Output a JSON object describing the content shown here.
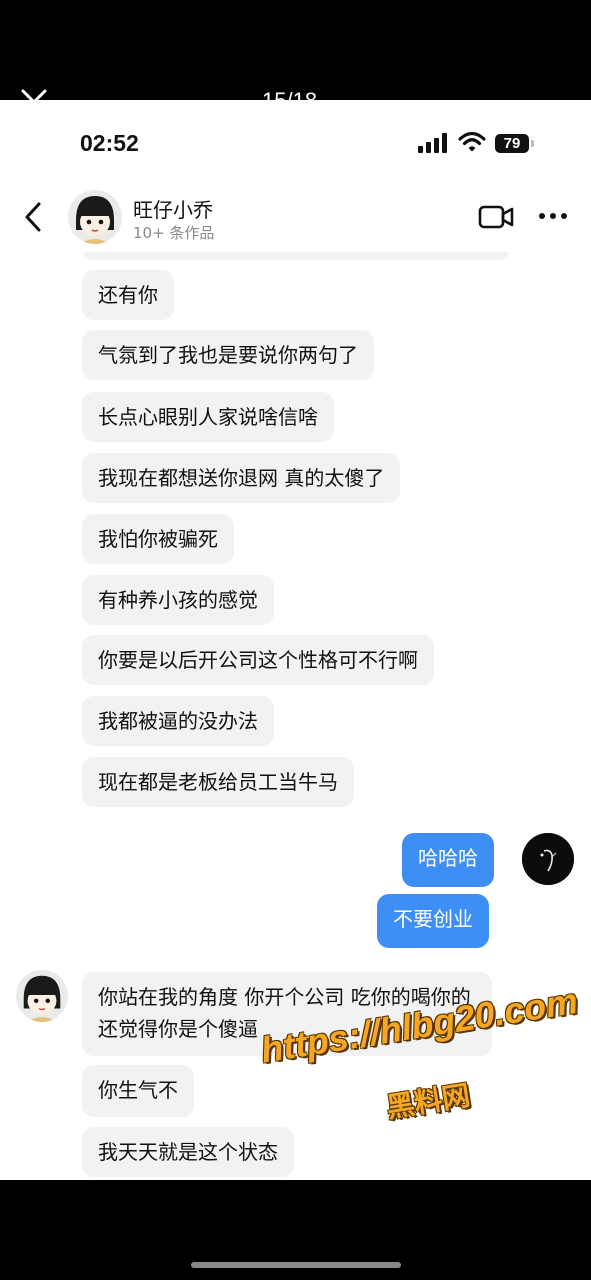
{
  "viewer": {
    "counter": "15/18",
    "close_icon": "close-icon"
  },
  "status_bar": {
    "time": "02:52",
    "battery": "79",
    "icons": [
      "signal-icon",
      "wifi-icon",
      "battery-icon"
    ]
  },
  "header": {
    "contact_name": "旺仔小乔",
    "subtitle": "10+ 条作品",
    "icons": [
      "back-icon",
      "video-call-icon",
      "more-icon"
    ]
  },
  "messages": [
    {
      "side": "in",
      "text": "还有你"
    },
    {
      "side": "in",
      "text": "气氛到了我也是要说你两句了"
    },
    {
      "side": "in",
      "text": "长点心眼别人家说啥信啥"
    },
    {
      "side": "in",
      "text": "我现在都想送你退网 真的太傻了"
    },
    {
      "side": "in",
      "text": "我怕你被骗死"
    },
    {
      "side": "in",
      "text": "有种养小孩的感觉"
    },
    {
      "side": "in",
      "text": "你要是以后开公司这个性格可不行啊"
    },
    {
      "side": "in",
      "text": "我都被逼的没办法"
    },
    {
      "side": "in",
      "text": "现在都是老板给员工当牛马"
    },
    {
      "side": "out",
      "text": "哈哈哈"
    },
    {
      "side": "out",
      "text": "不要创业"
    },
    {
      "side": "in",
      "text": "你站在我的角度 你开个公司 吃你的喝你的 还觉得你是个傻逼"
    },
    {
      "side": "in",
      "text": "你生气不"
    },
    {
      "side": "in",
      "text": "我天天就是这个状态"
    }
  ],
  "watermark": {
    "url": "https://hlbg20.com",
    "label": "黑料网",
    "color": "#f5a623"
  },
  "colors": {
    "incoming_bubble": "#f1f2f4",
    "outgoing_bubble": "#3d8ef5"
  }
}
